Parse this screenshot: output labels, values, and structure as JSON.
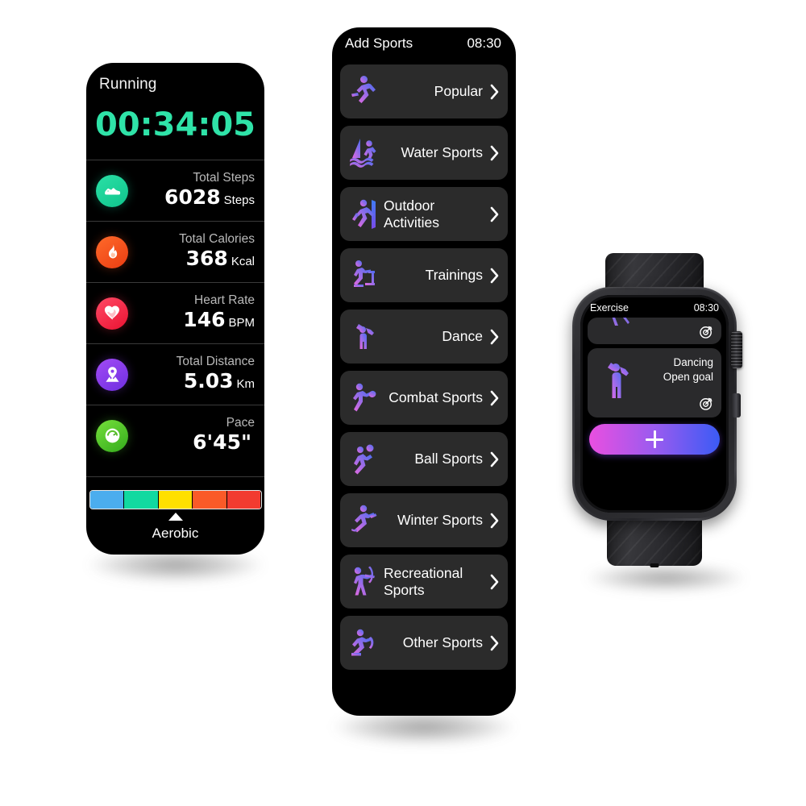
{
  "colors": {
    "timer_green": "#2fe3a8",
    "card_bg": "#2b2b2b",
    "screen_bg": "#000000",
    "add_gradient_from": "#e94fe0",
    "add_gradient_mid": "#9a5bef",
    "add_gradient_to": "#3b5bf5"
  },
  "running_panel": {
    "title": "Running",
    "timer": "00:34:05",
    "metrics": [
      {
        "icon": "shoe-icon",
        "icon_color": "#18d39b",
        "label": "Total Steps",
        "value": "6028",
        "unit": "Steps"
      },
      {
        "icon": "flame-icon",
        "icon_color": "#f4521f",
        "label": "Total Calories",
        "value": "368",
        "unit": "Kcal"
      },
      {
        "icon": "heart-icon",
        "icon_color": "#f5304a",
        "label": "Heart Rate",
        "value": "146",
        "unit": "BPM"
      },
      {
        "icon": "location-pin-icon",
        "icon_color": "#8a3df0",
        "label": "Total Distance",
        "value": "5.03",
        "unit": "Km"
      },
      {
        "icon": "speedometer-icon",
        "icon_color": "#4cc22a",
        "label": "Pace",
        "value": "6'45\"",
        "unit": ""
      }
    ],
    "zone_bar": {
      "segments": [
        "#4badee",
        "#12d9a0",
        "#ffe000",
        "#fa5a28",
        "#f23b30"
      ],
      "active_index": 2,
      "label": "Aerobic"
    }
  },
  "sports_panel": {
    "title": "Add Sports",
    "time": "08:30",
    "items": [
      {
        "label": "Popular",
        "icon": "running-person-icon",
        "two_line": false
      },
      {
        "label": "Water Sports",
        "icon": "windsurfer-icon",
        "two_line": false
      },
      {
        "label": "Outdoor Activities",
        "icon": "climber-icon",
        "two_line": true
      },
      {
        "label": "Trainings",
        "icon": "rowing-machine-icon",
        "two_line": false
      },
      {
        "label": "Dance",
        "icon": "dancer-icon",
        "two_line": false
      },
      {
        "label": "Combat Sports",
        "icon": "boxer-icon",
        "two_line": false
      },
      {
        "label": "Ball Sports",
        "icon": "volleyball-player-icon",
        "two_line": false
      },
      {
        "label": "Winter Sports",
        "icon": "ice-skater-icon",
        "two_line": false
      },
      {
        "label": "Recreational Sports",
        "icon": "archer-icon",
        "two_line": true
      },
      {
        "label": "Other Sports",
        "icon": "jump-rope-icon",
        "two_line": false
      }
    ],
    "chevron_icon": "chevron-right-icon"
  },
  "watch": {
    "status_title": "Exercise",
    "status_time": "08:30",
    "cards": [
      {
        "name": "partial-card",
        "title": "",
        "subtitle": "",
        "goal_icon": "target-goal-icon"
      },
      {
        "name": "dancing-card",
        "title": "Dancing",
        "subtitle": "Open goal",
        "goal_icon": "target-goal-icon",
        "icon": "dancer-icon"
      }
    ],
    "add_button": {
      "icon": "plus-icon",
      "label": ""
    }
  }
}
